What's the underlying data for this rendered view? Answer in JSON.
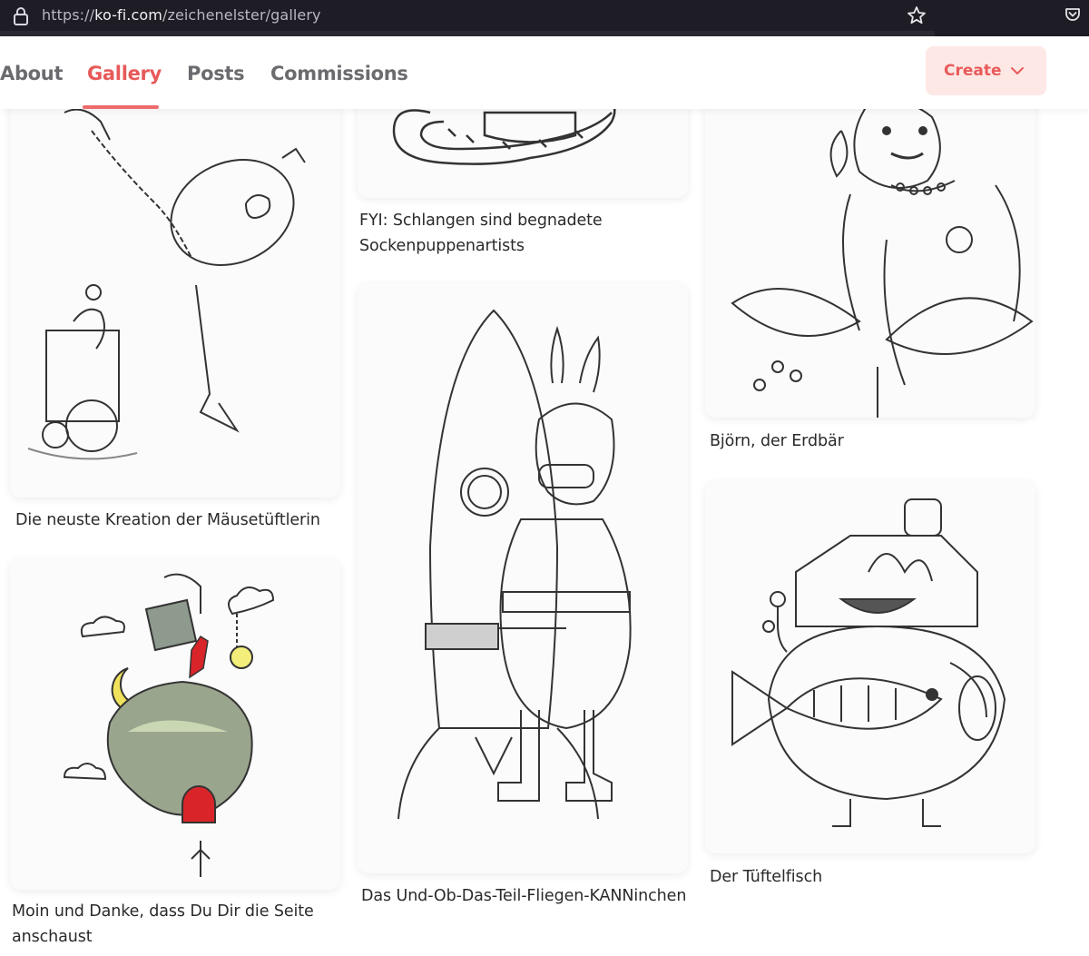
{
  "browser": {
    "url_scheme": "https://",
    "url_host": "ko-fi.com",
    "url_path": "/zeichenelster/gallery"
  },
  "nav": {
    "tabs": [
      {
        "label": "About",
        "active": false
      },
      {
        "label": "Gallery",
        "active": true
      },
      {
        "label": "Posts",
        "active": false
      },
      {
        "label": "Commissions",
        "active": false
      }
    ],
    "create_label": "Create",
    "accent_color": "#e85a5a"
  },
  "gallery": {
    "items": [
      {
        "caption": "Die neuste Kreation der Mäusetüftlerin"
      },
      {
        "caption": "Moin und Danke, dass Du Dir die Seite anschaust"
      },
      {
        "caption": "FYI: Schlangen sind begnadete Sockenpuppenartists"
      },
      {
        "caption": "Das Und-Ob-Das-Teil-Fliegen-KANNinchen"
      },
      {
        "caption": "Björn, der Erdbär"
      },
      {
        "caption": "Der Tüftelfisch"
      }
    ]
  }
}
